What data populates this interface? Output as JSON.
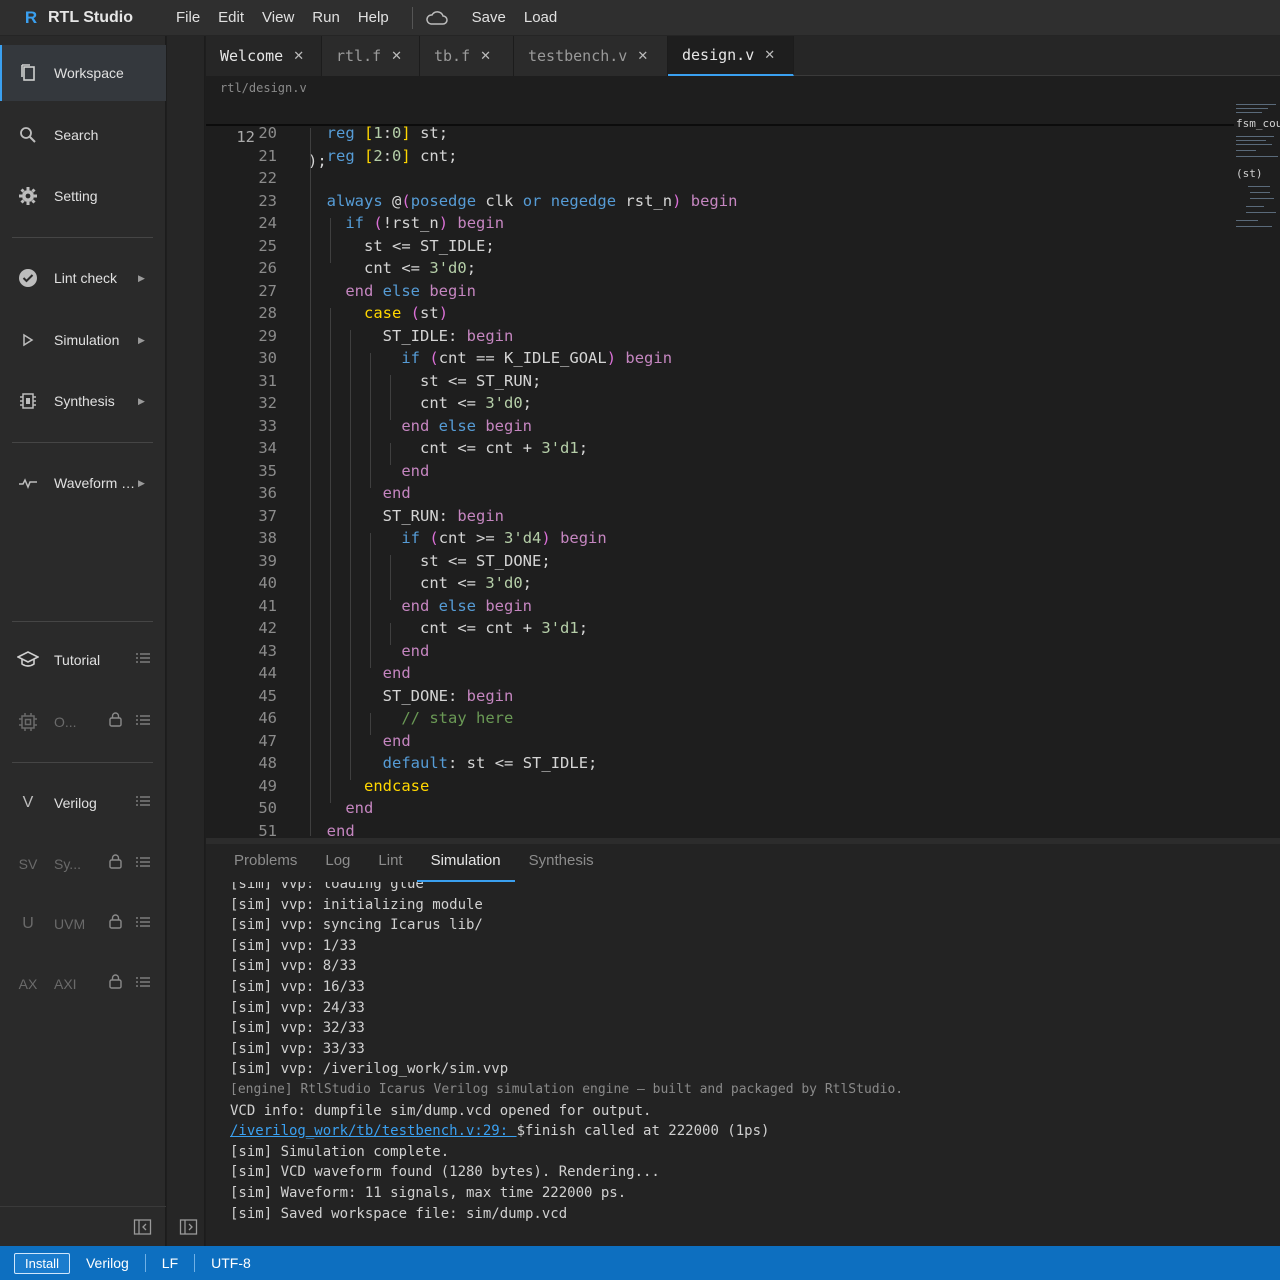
{
  "app": {
    "title": "RTL Studio",
    "logo": "R"
  },
  "menu": [
    "File",
    "Edit",
    "View",
    "Run",
    "Help"
  ],
  "toolbar": {
    "save_label": "Save",
    "load_label": "Load"
  },
  "sidebar": {
    "items": [
      {
        "label": "Workspace",
        "icon": "files-icon",
        "active": true
      },
      {
        "label": "Search",
        "icon": "search-icon"
      },
      {
        "label": "Setting",
        "icon": "gear-icon"
      },
      {
        "label": "Lint check",
        "icon": "check-circle-icon",
        "arrow": "▶"
      },
      {
        "label": "Simulation",
        "icon": "play-icon",
        "arrow": "▶"
      },
      {
        "label": "Synthesis",
        "icon": "chip-icon",
        "arrow": "▶"
      },
      {
        "label": "Waveform edi...",
        "icon": "waveform-icon",
        "arrow": "▶"
      },
      {
        "label": "Tutorial",
        "icon": "graduation-cap-icon"
      },
      {
        "label": "O...",
        "icon": "chip-icon",
        "locked": true
      },
      {
        "label": "Verilog",
        "icon": "V"
      },
      {
        "label": "Sy...",
        "icon": "SV",
        "locked": true
      },
      {
        "label": "UVM",
        "icon": "U",
        "locked": true
      },
      {
        "label": "AXI",
        "icon": "AX",
        "locked": true
      }
    ]
  },
  "tabs": [
    {
      "label": "Welcome"
    },
    {
      "label": "rtl.f"
    },
    {
      "label": "tb.f"
    },
    {
      "label": "testbench.v"
    },
    {
      "label": "design.v",
      "active": true
    }
  ],
  "breadcrumb": "rtl/design.v",
  "sticky": {
    "num": "12",
    "text": ");"
  },
  "minimap": {
    "label1": "fsm_cou",
    "label2": "(st)"
  },
  "editor": {
    "lines": [
      {
        "n": "20",
        "t": "  reg [1:0] st;"
      },
      {
        "n": "21",
        "t": "  reg [2:0] cnt;"
      },
      {
        "n": "22",
        "t": ""
      },
      {
        "n": "23",
        "t": "  always @(posedge clk or negedge rst_n) begin"
      },
      {
        "n": "24",
        "t": "    if (!rst_n) begin"
      },
      {
        "n": "25",
        "t": "      st <= ST_IDLE;"
      },
      {
        "n": "26",
        "t": "      cnt <= 3'd0;"
      },
      {
        "n": "27",
        "t": "    end else begin"
      },
      {
        "n": "28",
        "t": "      case (st)"
      },
      {
        "n": "29",
        "t": "        ST_IDLE: begin"
      },
      {
        "n": "30",
        "t": "          if (cnt == K_IDLE_GOAL) begin"
      },
      {
        "n": "31",
        "t": "            st <= ST_RUN;"
      },
      {
        "n": "32",
        "t": "            cnt <= 3'd0;"
      },
      {
        "n": "33",
        "t": "          end else begin"
      },
      {
        "n": "34",
        "t": "            cnt <= cnt + 3'd1;"
      },
      {
        "n": "35",
        "t": "          end"
      },
      {
        "n": "36",
        "t": "        end"
      },
      {
        "n": "37",
        "t": "        ST_RUN: begin"
      },
      {
        "n": "38",
        "t": "          if (cnt >= 3'd4) begin"
      },
      {
        "n": "39",
        "t": "            st <= ST_DONE;"
      },
      {
        "n": "40",
        "t": "            cnt <= 3'd0;"
      },
      {
        "n": "41",
        "t": "          end else begin"
      },
      {
        "n": "42",
        "t": "            cnt <= cnt + 3'd1;"
      },
      {
        "n": "43",
        "t": "          end"
      },
      {
        "n": "44",
        "t": "        end"
      },
      {
        "n": "45",
        "t": "        ST_DONE: begin"
      },
      {
        "n": "46",
        "t": "          // stay here"
      },
      {
        "n": "47",
        "t": "        end"
      },
      {
        "n": "48",
        "t": "        default: st <= ST_IDLE;"
      },
      {
        "n": "49",
        "t": "      endcase"
      },
      {
        "n": "50",
        "t": "    end"
      },
      {
        "n": "51",
        "t": "  end"
      }
    ]
  },
  "panel": {
    "tabs": [
      "Problems",
      "Log",
      "Lint",
      "Simulation",
      "Synthesis"
    ],
    "active_tab": "Simulation",
    "log": [
      {
        "t": "[sim] vvp: loading glue"
      },
      {
        "t": "[sim] vvp: initializing module"
      },
      {
        "t": "[sim] vvp: syncing Icarus lib/"
      },
      {
        "t": "[sim] vvp: 1/33"
      },
      {
        "t": "[sim] vvp: 8/33"
      },
      {
        "t": "[sim] vvp: 16/33"
      },
      {
        "t": "[sim] vvp: 24/33"
      },
      {
        "t": "[sim] vvp: 32/33"
      },
      {
        "t": "[sim] vvp: 33/33"
      },
      {
        "t": "[sim] vvp: /iverilog_work/sim.vvp"
      },
      {
        "t": "[engine] RtlStudio Icarus Verilog simulation engine — built and packaged by RtlStudio.",
        "dim": true
      },
      {
        "t": "VCD info: dumpfile sim/dump.vcd opened for output."
      },
      {
        "link": "/iverilog_work/tb/testbench.v:29: ",
        "t": "$finish called at 222000 (1ps)"
      },
      {
        "t": "[sim] Simulation complete."
      },
      {
        "t": "[sim] VCD waveform found (1280 bytes). Rendering..."
      },
      {
        "t": "[sim] Waveform: 11 signals, max time 222000 ps."
      },
      {
        "t": "[sim] Saved workspace file: sim/dump.vcd"
      }
    ]
  },
  "statusbar": {
    "install": "Install",
    "language": "Verilog",
    "eol": "LF",
    "encoding": "UTF-8"
  },
  "colors": {
    "accent": "#3aa0f0",
    "status": "#0d6fc0"
  }
}
